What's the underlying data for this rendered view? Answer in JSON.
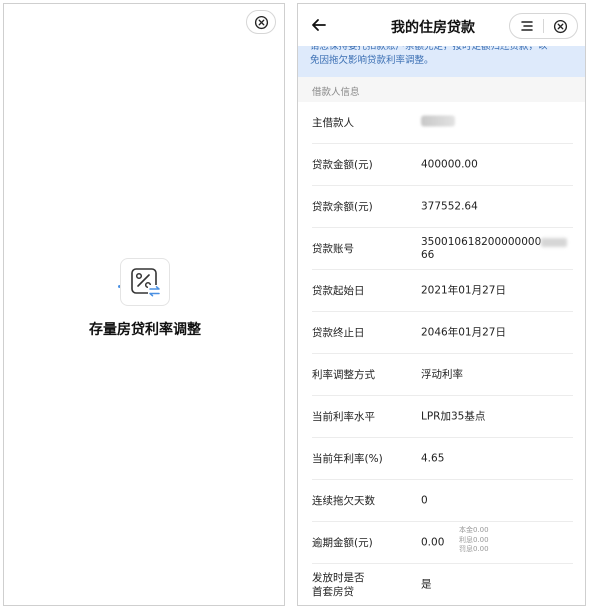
{
  "left": {
    "title": "存量房贷利率调整",
    "icon": "percent-exchange-icon",
    "close_icon": "close-icon"
  },
  "right": {
    "header": {
      "back_icon": "arrow-left-icon",
      "title": "我的住房贷款",
      "menu_icon": "menu-icon",
      "close_icon": "close-icon"
    },
    "notice": {
      "line1": "请您保持委托扣款账户余额充足，按时足额归还贷款，以",
      "line2": "免因拖欠影响贷款利率调整。"
    },
    "section_title": "借款人信息",
    "rows": [
      {
        "label": "主借款人",
        "value": ""
      },
      {
        "label": "贷款金额(元)",
        "value": "400000.00"
      },
      {
        "label": "贷款余额(元)",
        "value": "377552.64"
      },
      {
        "label": "贷款账号",
        "value_line1": "350010618200000000",
        "value_line2": "66"
      },
      {
        "label": "贷款起始日",
        "value": "2021年01月27日"
      },
      {
        "label": "贷款终止日",
        "value": "2046年01月27日"
      },
      {
        "label": "利率调整方式",
        "value": "浮动利率"
      },
      {
        "label": "当前利率水平",
        "value": "LPR加35基点"
      },
      {
        "label": "当前年利率(%)",
        "value": "4.65"
      },
      {
        "label": "连续拖欠天数",
        "value": "0"
      },
      {
        "label": "逾期金额(元)",
        "value": "0.00",
        "breakdown": [
          "本金0.00",
          "利息0.00",
          "罚息0.00"
        ]
      },
      {
        "label_line1": "发放时是否",
        "label_line2": "首套房贷",
        "value": "是"
      }
    ]
  },
  "colors": {
    "accent_blue": "#4a90e2",
    "notice_bg": "#deeafb",
    "notice_text": "#3b6fb3"
  }
}
